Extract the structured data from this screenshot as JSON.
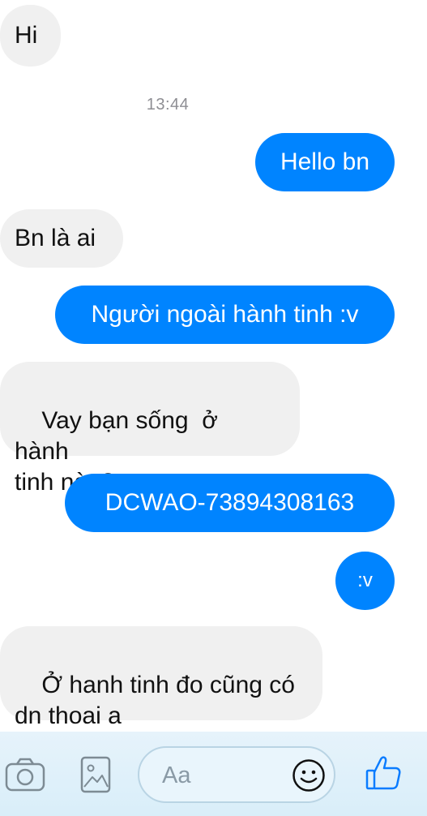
{
  "messages": [
    {
      "sender": "them",
      "text": "Hi"
    },
    {
      "sender": "me",
      "text": "Hello bn"
    },
    {
      "sender": "them",
      "text": "Bn là ai"
    },
    {
      "sender": "me",
      "text": "Người ngoài hành tinh :v"
    },
    {
      "sender": "them",
      "text": "Vay bạn sống  ở hành\ntinh nào?"
    },
    {
      "sender": "me",
      "text": "DCWAO-73894308163"
    },
    {
      "sender": "me",
      "text": ":v"
    },
    {
      "sender": "them",
      "text": "Ở hanh tinh đo cũng có\ndn thoai a"
    }
  ],
  "timestamp": "13:44",
  "composer": {
    "placeholder": "Aa",
    "icons": [
      "camera-icon",
      "photo-icon",
      "emoji-icon",
      "thumbs-up-icon"
    ]
  },
  "colors": {
    "outgoing_bubble": "#0084ff",
    "incoming_bubble": "#f0f0f0",
    "accent_icon": "#0a7cff"
  }
}
